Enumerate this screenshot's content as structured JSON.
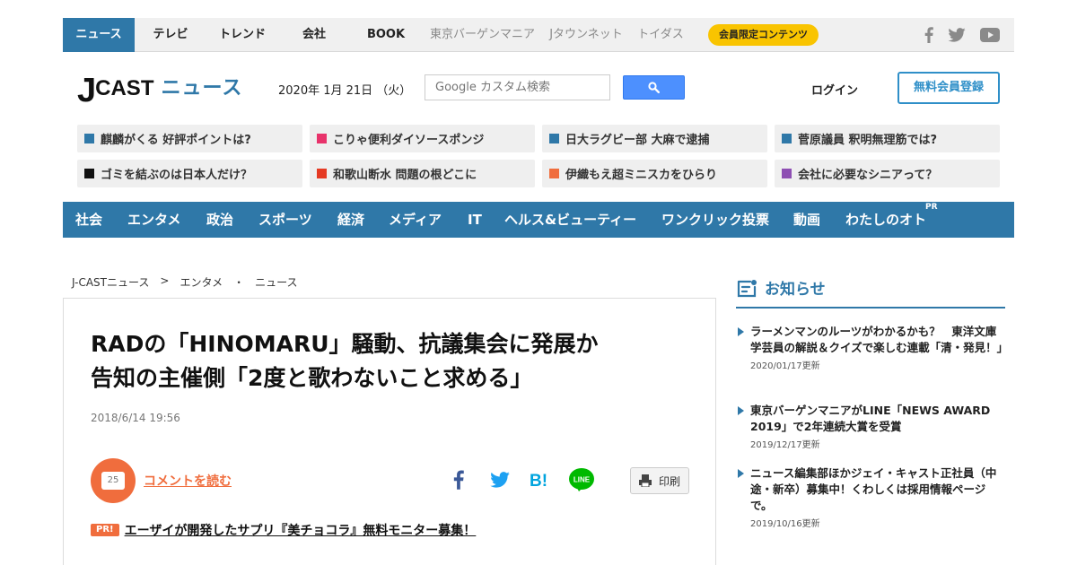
{
  "topnav": {
    "items": [
      "ニュース",
      "テレビ",
      "トレンド",
      "会社",
      "BOOK",
      "東京バーゲンマニア",
      "Jタウンネット",
      "トイダス"
    ],
    "member_badge": "会員限定コンテンツ",
    "social": [
      "facebook-icon",
      "twitter-icon",
      "youtube-icon"
    ]
  },
  "header": {
    "logo_j": "J",
    "logo_cast": "CAST",
    "logo_news": "ニュース",
    "date": "2020年 1月 21日 （火）",
    "search_placeholder": "Google カスタム検索",
    "login": "ログイン",
    "register": "無料会員登録"
  },
  "trending": [
    {
      "text": "麒麟がくる 好評ポイントは?",
      "color": "#2f78a8"
    },
    {
      "text": "こりゃ便利ダイソースポンジ",
      "color": "#e8336b"
    },
    {
      "text": "日大ラグビー部 大麻で逮捕",
      "color": "#2f78a8"
    },
    {
      "text": "菅原議員 釈明無理筋では?",
      "color": "#2f78a8"
    },
    {
      "text": "ゴミを結ぶのは日本人だけ？",
      "color": "#111111"
    },
    {
      "text": "和歌山断水 問題の根どこに",
      "color": "#e53a23"
    },
    {
      "text": "伊織もえ超ミニスカをひらり",
      "color": "#f06d3d"
    },
    {
      "text": "会社に必要なシニアって？",
      "color": "#8e4fb3"
    }
  ],
  "categories": [
    "社会",
    "エンタメ",
    "政治",
    "スポーツ",
    "経済",
    "メディア",
    "IT",
    "ヘルス&ビューティー",
    "ワンクリック投票",
    "動画",
    "わたしのオト"
  ],
  "categories_pr": "PR",
  "breadcrumb": [
    "J-CASTニュース",
    ">",
    "エンタメ",
    "・",
    "ニュース"
  ],
  "article": {
    "title_line1": "RADの「HINOMARU」騒動、抗議集会に発展か",
    "title_line2": "告知の主催側「2度と歌わないこと求める」",
    "date": "2018/6/14 19:56",
    "comment_count": "25",
    "comment_link": "コメントを読む",
    "share_icons": [
      "facebook-icon",
      "twitter-icon",
      "hatena-bookmark-icon",
      "line-icon"
    ],
    "print_label": "印刷",
    "pr_tag": "PR!",
    "pr_text": "エーザイが開発したサプリ『美チョコラ』無料モニター募集！"
  },
  "sidebar": {
    "title": "お知らせ",
    "notices": [
      {
        "text": "ラーメンマンのルーツがわかるかも？　東洋文庫学芸員の解説＆クイズで楽しむ連載「清・発見！」",
        "date": "2020/01/17更新"
      },
      {
        "text": "東京バーゲンマニアがLINE「NEWS AWARD 2019」で2年連続大賞を受賞",
        "date": "2019/12/17更新"
      },
      {
        "text": "ニュース編集部ほかジェイ・キャスト正社員（中途・新卒）募集中！くわしくは採用情報ページで。",
        "date": "2019/10/16更新"
      }
    ]
  }
}
